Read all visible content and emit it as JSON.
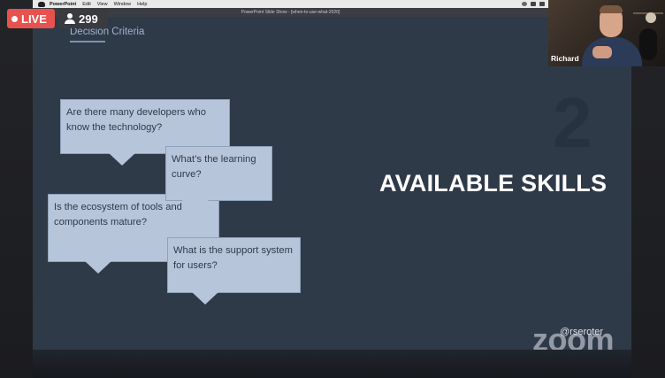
{
  "menubar": {
    "items": [
      "PowerPoint",
      "Edit",
      "View",
      "Window",
      "Help"
    ]
  },
  "window": {
    "title": "PowerPoint Slide Show - [when-to-use-what-2020]"
  },
  "stream": {
    "live_label": "LIVE",
    "viewers": "299"
  },
  "slide": {
    "section_title": "Decision Criteria",
    "bubbles": [
      "Are there many developers who know the technology?",
      "What’s the learning curve?",
      "Is the ecosystem of tools and components mature?",
      "What is the support system for users?"
    ],
    "number": "2",
    "headline": "AVAILABLE SKILLS",
    "handle": "@rseroter"
  },
  "watermark": "zoom",
  "webcam": {
    "participant_name": "Richard"
  },
  "colors": {
    "slide_bg": "#2f3a49",
    "bubble_bg": "#b7c5db",
    "live_red": "#e8524e"
  }
}
